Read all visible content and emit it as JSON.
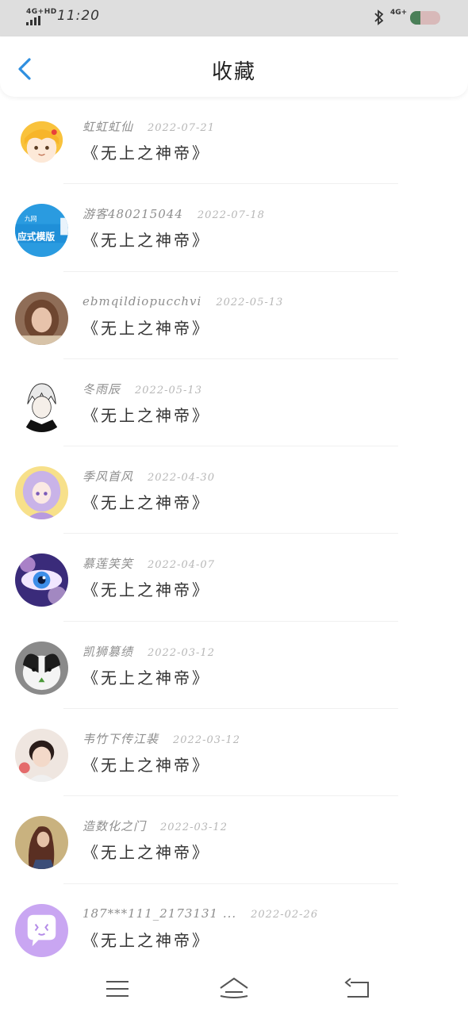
{
  "status_bar": {
    "network": "4G+HD",
    "time": "11:20",
    "network_right": "4G+",
    "battery_fraction": 0.35
  },
  "header": {
    "title": "收藏",
    "back_icon": "chevron-left-icon",
    "accent_color": "#2f8fe0"
  },
  "favorites": [
    {
      "user": "虹虹虹仙",
      "date": "2022-07-21",
      "book": "《无上之神帝》",
      "avatar": "cartoon-girl-avatar"
    },
    {
      "user": "游客480215044",
      "date": "2022-07-18",
      "book": "《无上之神帝》",
      "avatar": "template-banner-avatar",
      "avatar_text_top": "九网",
      "avatar_text": "应式模版"
    },
    {
      "user": "ebmqildiopucchvi",
      "date": "2022-05-13",
      "book": "《无上之神帝》",
      "avatar": "woman-photo-avatar"
    },
    {
      "user": "冬雨辰",
      "date": "2022-05-13",
      "book": "《无上之神帝》",
      "avatar": "anime-white-hair-avatar"
    },
    {
      "user": "季风首风",
      "date": "2022-04-30",
      "book": "《无上之神帝》",
      "avatar": "anime-purple-hair-avatar"
    },
    {
      "user": "慕莲笑笑",
      "date": "2022-04-07",
      "book": "《无上之神帝》",
      "avatar": "galaxy-eye-avatar"
    },
    {
      "user": "凯狮篡绩",
      "date": "2022-03-12",
      "book": "《无上之神帝》",
      "avatar": "rabbit-photo-avatar"
    },
    {
      "user": "韦竹下传江裴",
      "date": "2022-03-12",
      "book": "《无上之神帝》",
      "avatar": "child-photo-avatar"
    },
    {
      "user": "造数化之门",
      "date": "2022-03-12",
      "book": "《无上之神帝》",
      "avatar": "long-hair-photo-avatar"
    },
    {
      "user": "187***111_2173131 ...",
      "date": "2022-02-26",
      "book": "《无上之神帝》",
      "avatar": "chat-bubble-avatar"
    }
  ],
  "nav_bar": {
    "menu_icon": "menu-icon",
    "home_icon": "home-icon",
    "back_icon": "back-arrow-icon"
  }
}
